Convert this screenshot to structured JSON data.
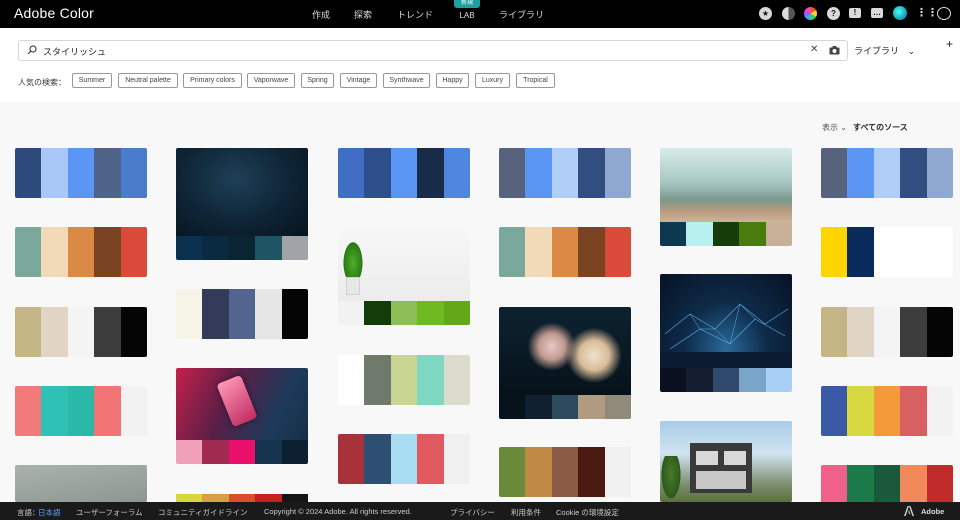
{
  "app": {
    "brand": "Adobe Color"
  },
  "nav": {
    "create": "作成",
    "explore": "探索",
    "trends": "トレンド",
    "lab": "LAB",
    "lab_badge": "新規",
    "libraries": "ライブラリ"
  },
  "search": {
    "value": "スタイリッシュ",
    "placeholder": "",
    "library_label": "ライブラリ"
  },
  "popular": {
    "label": "人気の検索：",
    "tags": [
      "Summer",
      "Neutral palette",
      "Primary colors",
      "Vaporwave",
      "Spring",
      "Vintage",
      "Synthwave",
      "Happy",
      "Luxury",
      "Tropical"
    ]
  },
  "sort": {
    "view_label": "表示",
    "source_label": "すべてのソース"
  },
  "icons": {
    "search": "search-icon",
    "clear": "close-icon",
    "camera": "camera-icon",
    "chevron": "chevron-down-icon",
    "plus": "plus-icon",
    "header": [
      "star-icon",
      "moon-icon",
      "color-wheel-icon",
      "help-icon",
      "alert-icon",
      "chat-icon",
      "avatar",
      "apps-grid-icon",
      "creative-cloud-icon"
    ]
  },
  "palettes": [
    [
      "#2e4a7d",
      "#a8c8f8",
      "#5b96f5",
      "#4f6388",
      "#4a7ccc"
    ],
    [
      "#7aa99b",
      "#f2d9b8",
      "#db8a45",
      "#7a4422",
      "#d94a3a"
    ],
    [
      "#c4b585",
      "#e0d5c5",
      "#f4f4f4",
      "#3d3d3d",
      "#050505"
    ],
    [
      "#f27a7a",
      "#2fc0b6",
      "#2ab8a8",
      "#f27474",
      "#f2f2f2"
    ],
    [
      "#f6f4e6",
      "#333b58",
      "#52648f",
      "#e6e6e6",
      "#050505"
    ],
    [
      "#3f6ec4",
      "#2e4f8c",
      "#5b96f5",
      "#182b48",
      "#4f86e0"
    ],
    [
      "#ffffff",
      "#6f7a6c",
      "#c9d693",
      "#7fd8c1",
      "#dcdccc"
    ],
    [
      "#a8323a",
      "#2d4f73",
      "#a8dcf0",
      "#e05a5f",
      "#f0f0f0"
    ],
    [
      "#57637d",
      "#5b96f5",
      "#b0cdf8",
      "#324e80",
      "#8ea8cf"
    ],
    [
      "#7aa99b",
      "#f2d9b8",
      "#db8a45",
      "#7a4422",
      "#d94a3a"
    ],
    [
      "#6a8a3a",
      "#c08a45",
      "#8a5a45",
      "#4a1a10",
      "#f0f0f0"
    ],
    [
      "#57637d",
      "#5b96f5",
      "#b0cdf8",
      "#324e80",
      "#8ea8cf"
    ],
    [
      "#ffd400",
      "#0a2a5c",
      "#ffffff",
      "#ffffff",
      "#ffffff"
    ],
    [
      "#c4b585",
      "#e0d5c5",
      "#f4f4f4",
      "#3d3d3d",
      "#050505"
    ],
    [
      "#3a5aa8",
      "#d8d840",
      "#f59a3a",
      "#d86060",
      "#f2f2f2"
    ],
    [
      "#f0608a",
      "#1a7a4a",
      "#1a5a3a",
      "#f08a5a",
      "#c02a2a"
    ]
  ],
  "image_strips": [
    [
      "#0c3050",
      "#0a2a40",
      "#0a2432",
      "#1e5565",
      "#a0a4a8"
    ],
    [
      "#f0a0b8",
      "#a02a50",
      "#e8106a",
      "#163450",
      "#0c2032"
    ],
    [
      "#f2f2f2",
      "#123c0a",
      "#8cbf55",
      "#6fba20",
      "#62a818"
    ],
    [
      "#06121c",
      "#10202e",
      "#2e4a5e",
      "#b09a80",
      "#908a7a"
    ],
    [
      "#0e3850",
      "#b8f0f0",
      "#163c0a",
      "#4a7c0c",
      "#c8b098"
    ],
    [
      "#0a1020",
      "#141e30",
      "#304a6e",
      "#7aa4c8",
      "#a8d0f4"
    ]
  ],
  "footer": {
    "language_label": "言語：",
    "language_value": "日本語",
    "links": [
      "ユーザーフォーラム",
      "コミュニティガイドライン",
      "Copyright © 2024 Adobe. All rights reserved.",
      "プライバシー",
      "利用条件",
      "Cookie の環境設定"
    ],
    "brand": "Adobe"
  }
}
